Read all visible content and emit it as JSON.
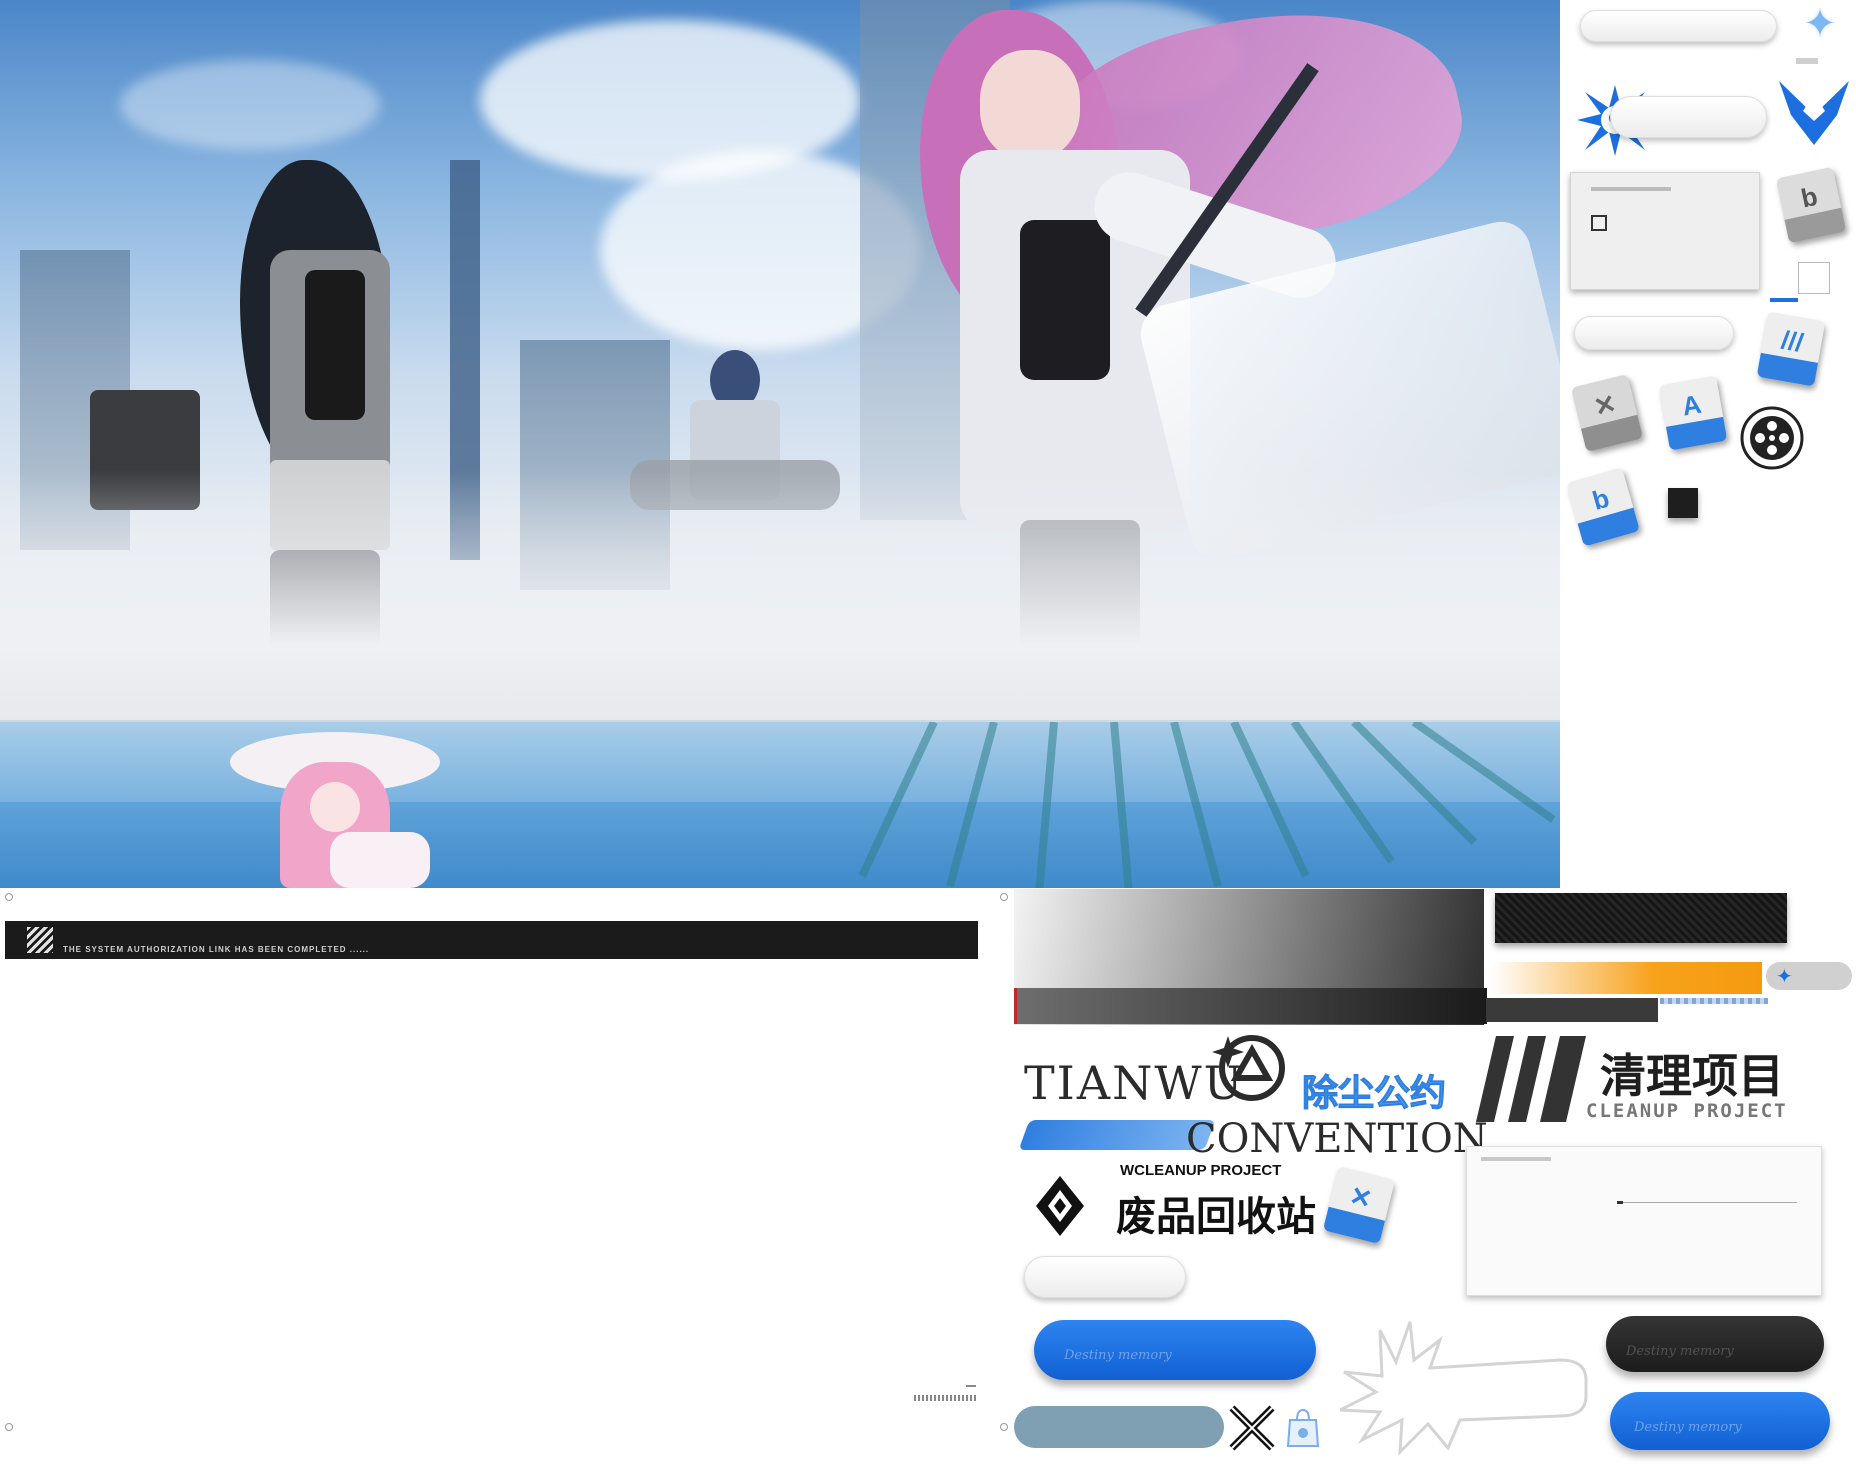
{
  "panel": {
    "status_message": "THE SYSTEM AUTHORIZATION LINK HAS BEEN COMPLETED ......"
  },
  "logos": {
    "tianwu": "TIANWU",
    "convention": "CONVENTION",
    "tianwu_cn": "除尘公约",
    "cleanup_cn": "清理项目",
    "cleanup_en": "CLEANUP PROJECT",
    "wcleanup": "WCLEANUP PROJECT",
    "recycle_cn": "废品回收站"
  },
  "buttons": {
    "watermark": "Destiny memory"
  },
  "icons": [
    "star-sparkle-icon",
    "splash-icon",
    "chevron-crest-icon",
    "file-b-icon",
    "file-cleanup-icon",
    "file-broken-icon",
    "file-a-icon",
    "film-reel-icon",
    "crossed-swords-icon",
    "bag-icon",
    "diamond-emblem-icon"
  ],
  "colors": {
    "accent_blue": "#1d6fe0",
    "orange": "#f7a21b",
    "dark": "#222222",
    "steel": "#7f9fb3"
  }
}
